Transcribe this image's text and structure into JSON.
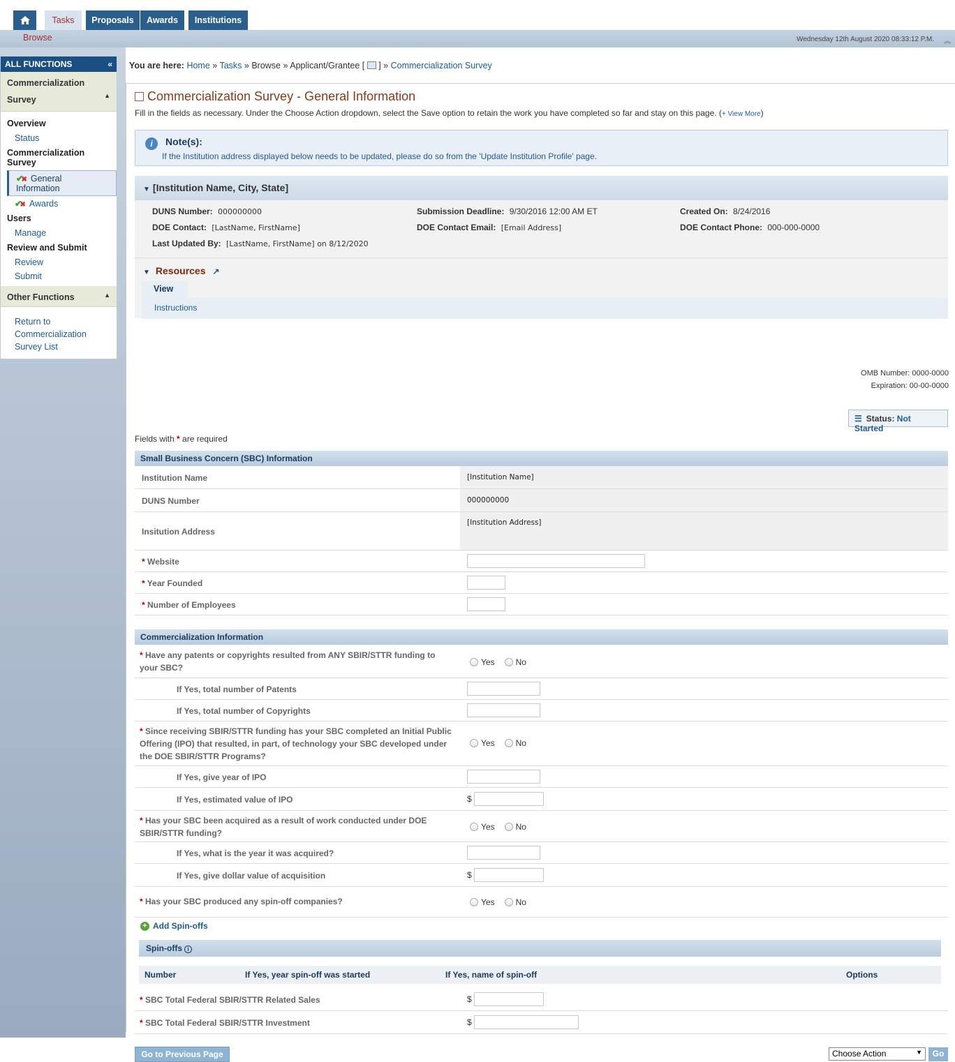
{
  "nav": {
    "tabs": [
      "Tasks",
      "Proposals",
      "Awards",
      "Institutions"
    ],
    "subtab": "Browse",
    "datetime": "Wednesday 12th August 2020 08:33:12 P.M."
  },
  "sidebar": {
    "title": "ALL FUNCTIONS",
    "section1": "Commercialization Survey",
    "groups": {
      "overview": "Overview",
      "status": "Status",
      "survey": "Commercialization Survey",
      "general": "General Information",
      "awards": "Awards",
      "users": "Users",
      "manage": "Manage",
      "review_submit": "Review and Submit",
      "review": "Review",
      "submit": "Submit"
    },
    "section2": "Other Functions",
    "return_link": "Return to Commercialization Survey List"
  },
  "breadcrumb": {
    "prefix": "You are here:",
    "home": "Home",
    "tasks": "Tasks",
    "browse": "Browse",
    "applicant": "Applicant/Grantee [",
    "applicant_end": "]",
    "current": "Commercialization Survey"
  },
  "page": {
    "title": "Commercialization Survey - General Information",
    "description": "Fill in the fields as necessary. Under the Choose Action dropdown, select the Save option to retain the work you have completed so far and stay on this page.",
    "view_more": "+ View More"
  },
  "note": {
    "title": "Note(s):",
    "body": "If the Institution address displayed below needs to be updated, please do so from the 'Update Institution Profile' page."
  },
  "institution": {
    "header": "[Institution Name, City, State]",
    "duns_label": "DUNS Number:",
    "duns": "000000000",
    "deadline_label": "Submission Deadline:",
    "deadline": "9/30/2016 12:00 AM ET",
    "created_label": "Created On:",
    "created": "8/24/2016",
    "doe_contact_label": "DOE Contact:",
    "doe_contact": "[LastName, FirstName]",
    "doe_email_label": "DOE Contact Email:",
    "doe_email": "[Email Address]",
    "doe_phone_label": "DOE Contact Phone:",
    "doe_phone": "000-000-0000",
    "updated_label": "Last Updated By:",
    "updated": "[LastName, FirstName] on 8/12/2020"
  },
  "resources": {
    "title": "Resources",
    "tab": "View",
    "link": "Instructions"
  },
  "omb": {
    "number_label": "OMB Number:",
    "number": "0000-0000",
    "expiration_label": "Expiration:",
    "expiration": "00-00-0000"
  },
  "status": {
    "label": "Status:",
    "value": "Not Started"
  },
  "required_note": {
    "pre": "Fields with",
    "post": "are required"
  },
  "sbc": {
    "header": "Small Business Concern (SBC) Information",
    "institution_name_label": "Institution Name",
    "institution_name": "[Institution Name]",
    "duns_label": "DUNS Number",
    "duns": "000000000",
    "address_label": "Insitution Address",
    "address": "[Institution Address]",
    "website_label": "Website",
    "year_label": "Year Founded",
    "employees_label": "Number of Employees"
  },
  "commercialization": {
    "header": "Commercialization Information",
    "q_patents": "Have any patents or copyrights resulted from ANY SBIR/STTR funding to your SBC?",
    "q_patents_count": "If Yes, total number of Patents",
    "q_copyrights_count": "If Yes, total number of Copyrights",
    "q_ipo": "Since receiving SBIR/STTR funding has your SBC completed an Initial Public Offering (IPO) that resulted, in part, of technology your SBC developed under the DOE SBIR/STTR Programs?",
    "q_ipo_year": "If Yes, give year of IPO",
    "q_ipo_value": "If Yes, estimated value of IPO",
    "q_acquired": "Has your SBC been acquired as a result of work conducted under DOE SBIR/STTR funding?",
    "q_acq_year": "If Yes, what is the year it was acquired?",
    "q_acq_value": "If Yes, give dollar value of acquisition",
    "q_spinoffs": "Has your SBC produced any spin-off companies?",
    "yes": "Yes",
    "no": "No",
    "dollar": "$",
    "add_spinoffs": "Add Spin-offs",
    "spinoffs_header": "Spin-offs",
    "cols": [
      "Number",
      "If Yes, year spin-off was started",
      "If Yes, name of spin-off",
      "Options"
    ],
    "sales_label": "SBC Total Federal SBIR/STTR Related Sales",
    "investment_label": "SBC Total Federal SBIR/STTR Investment"
  },
  "footer": {
    "prev": "Go to Previous Page",
    "action": "Choose Action",
    "go": "Go"
  }
}
